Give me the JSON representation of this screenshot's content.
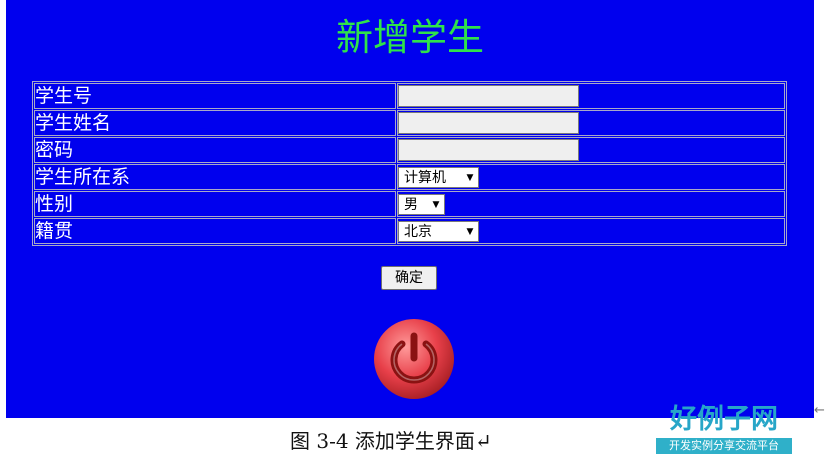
{
  "page": {
    "title": "新增学生",
    "confirm_label": "确定",
    "caption": "图 3-4    添加学生界面↵"
  },
  "form": {
    "rows": [
      {
        "label": "学生号",
        "type": "text",
        "value": ""
      },
      {
        "label": "学生姓名",
        "type": "text",
        "value": ""
      },
      {
        "label": "密码",
        "type": "text",
        "value": ""
      },
      {
        "label": "学生所在系",
        "type": "select",
        "value": "计算机"
      },
      {
        "label": "性别",
        "type": "select",
        "value": "男"
      },
      {
        "label": "籍贯",
        "type": "select",
        "value": "北京"
      }
    ]
  },
  "icons": {
    "power": "power-icon",
    "select_arrow": "chevron-down-icon"
  },
  "branding": {
    "name": "好例子网",
    "tagline": "开发实例分享交流平台"
  },
  "colors": {
    "background": "#0000ee",
    "title": "#2fe34a",
    "power_outer": "#e8404a",
    "power_ring": "#8a1212",
    "brand": "#27a6c8"
  }
}
